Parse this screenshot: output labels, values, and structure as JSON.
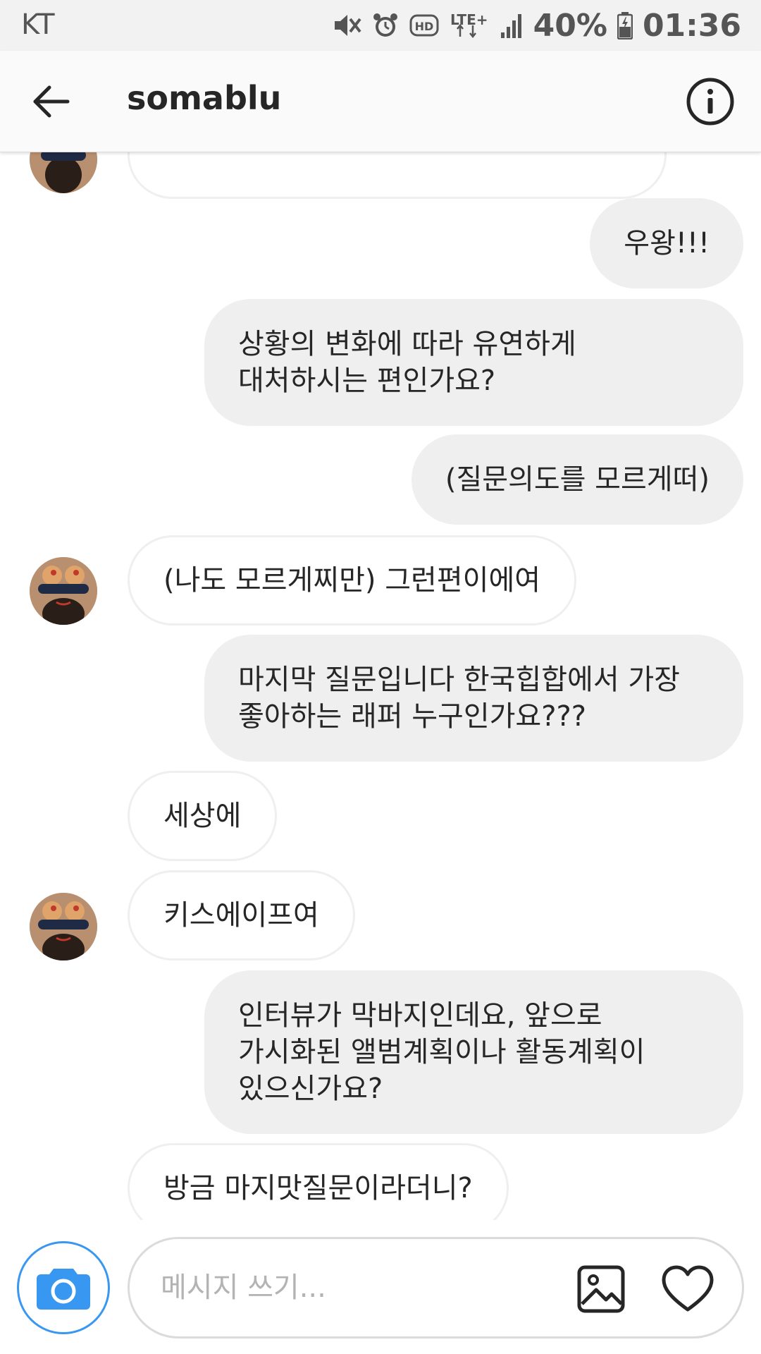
{
  "status_bar": {
    "carrier": "KT",
    "battery": "40%",
    "time": "01:36",
    "network": "LTE+",
    "icons": [
      "mute-icon",
      "alarm-icon",
      "hd-icon",
      "lte-icon",
      "signal-icon",
      "battery-icon"
    ]
  },
  "header": {
    "title": "somablu",
    "back_icon": "arrow-left-icon",
    "info_icon": "info-icon"
  },
  "messages": [
    {
      "direction": "in",
      "text": "…",
      "partial": true
    },
    {
      "direction": "out",
      "text": "우왕!!!"
    },
    {
      "direction": "out",
      "text": "상황의 변화에 따라 유연하게\n대처하시는 편인가요?"
    },
    {
      "direction": "out",
      "text": "(질문의도를 모르게떠)"
    },
    {
      "direction": "in",
      "text": "(나도 모르게찌만) 그런편이에여"
    },
    {
      "direction": "out",
      "text": "마지막 질문입니다 한국힙합에서 가장\n좋아하는 래퍼 누구인가요???"
    },
    {
      "direction": "in",
      "text": "세상에"
    },
    {
      "direction": "in",
      "text": "키스에이프여"
    },
    {
      "direction": "out",
      "text": "인터뷰가 막바지인데요, 앞으로\n가시화된 앨범계획이나 활동계획이\n있으신가요?"
    },
    {
      "direction": "in",
      "text": "방금 마지맛질문이라더니?"
    }
  ],
  "composer": {
    "placeholder": "메시지 쓰기...",
    "value": "",
    "camera_icon": "camera-icon",
    "gallery_icon": "image-icon",
    "like_icon": "heart-icon"
  },
  "colors": {
    "accent": "#3897f0",
    "outgoing_bubble": "#efefef",
    "incoming_border": "#efefef",
    "text": "#262626"
  }
}
